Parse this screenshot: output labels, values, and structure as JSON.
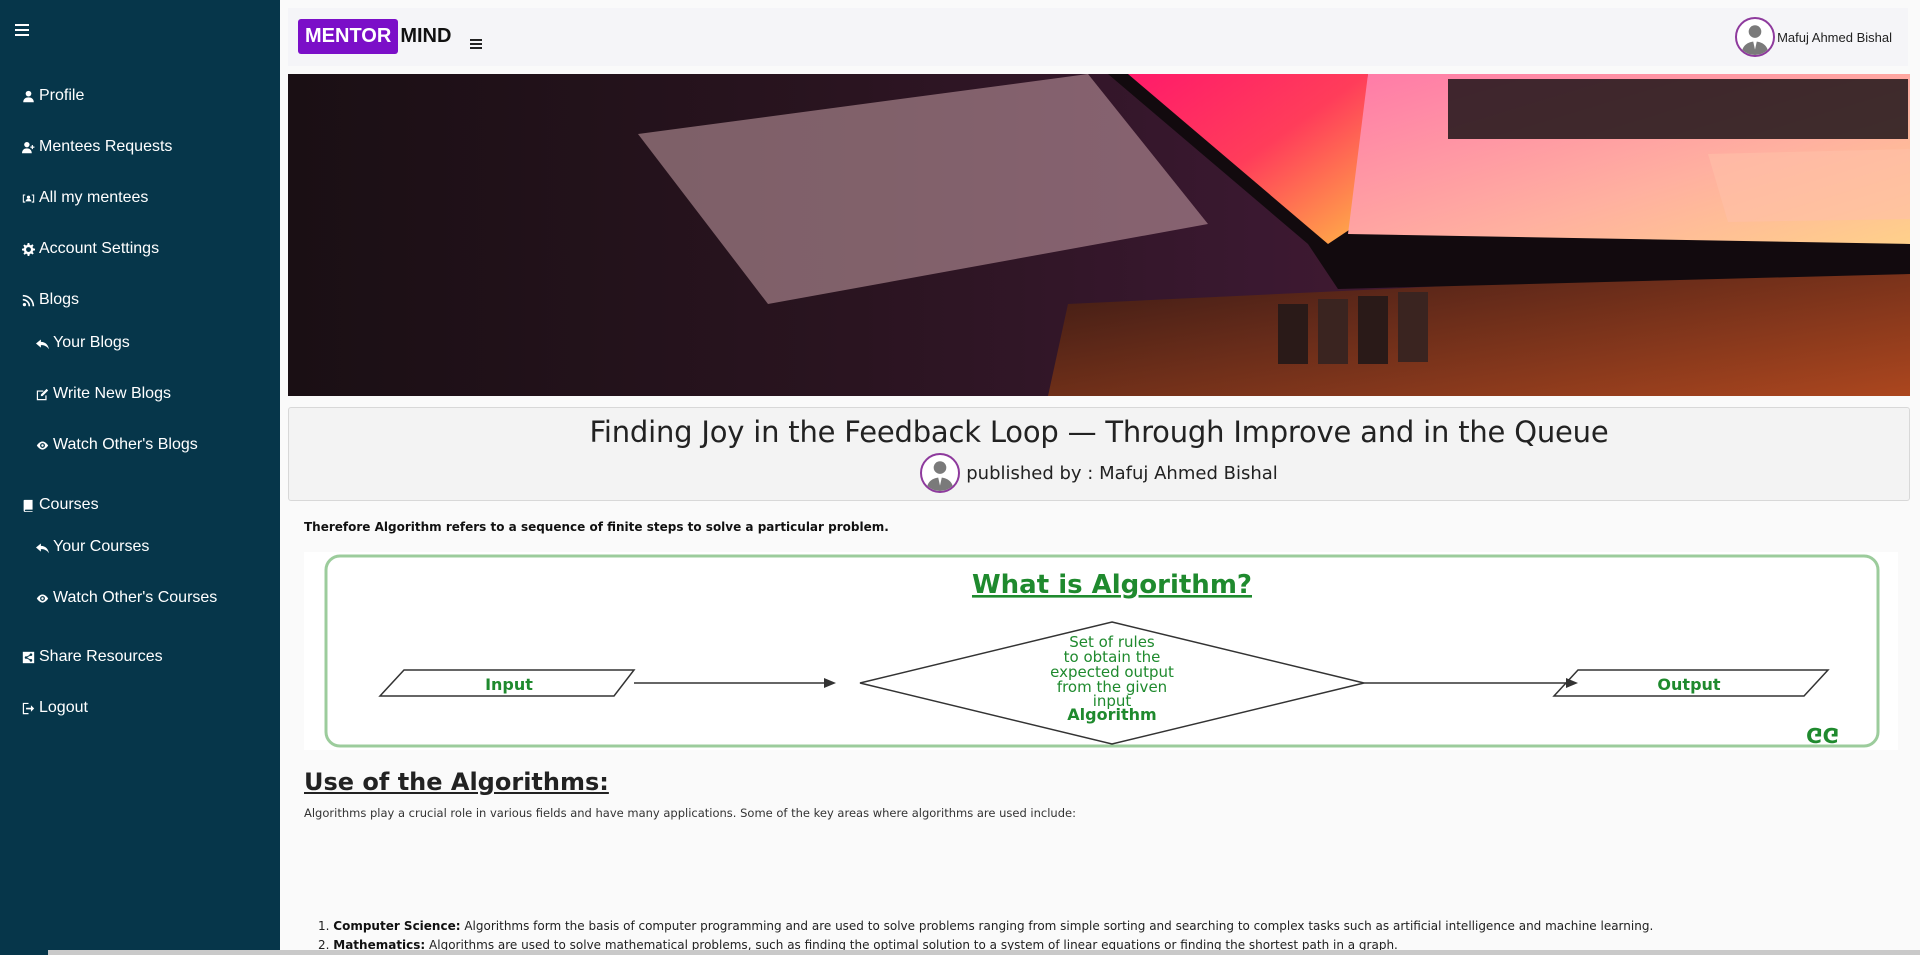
{
  "sidebar": {
    "items": [
      {
        "label": "Profile",
        "icon": "user-icon"
      },
      {
        "label": "Mentees Requests",
        "icon": "user-plus-icon"
      },
      {
        "label": "All my mentees",
        "icon": "people-card-icon"
      },
      {
        "label": "Account Settings",
        "icon": "gear-icon"
      },
      {
        "label": "Blogs",
        "icon": "rss-icon"
      },
      {
        "label": "Your Blogs",
        "icon": "reply-arrow-icon"
      },
      {
        "label": "Write New Blogs",
        "icon": "edit-icon"
      },
      {
        "label": "Watch Other's Blogs",
        "icon": "eye-icon"
      },
      {
        "label": "Courses",
        "icon": "book-icon"
      },
      {
        "label": "Your Courses",
        "icon": "reply-arrow-icon"
      },
      {
        "label": "Watch Other's Courses",
        "icon": "eye-icon"
      },
      {
        "label": "Share Resources",
        "icon": "share-icon"
      },
      {
        "label": "Logout",
        "icon": "logout-icon"
      }
    ]
  },
  "header": {
    "logo_part1": "MENTOR",
    "logo_part2": "MIND",
    "user_name": "Mafuj Ahmed Bishal"
  },
  "blog": {
    "title": "Finding Joy in the Feedback Loop — Through Improve and in the Queue",
    "published_by": "published by : Mafuj Ahmed Bishal",
    "intro": "Therefore Algorithm refers to a sequence of finite steps to solve a particular problem.",
    "diagram": {
      "title": "What is Algorithm?",
      "input": "Input",
      "rules_line1": "Set of rules",
      "rules_line2": "to obtain the",
      "rules_line3": "expected output",
      "rules_line4": "from the given",
      "rules_line5": "input",
      "algorithm": "Algorithm",
      "output": "Output",
      "watermark": "GG"
    },
    "section_heading": "Use of the Algorithms:",
    "section_para": "Algorithms play a crucial role in various fields and have many applications. Some of the key areas where algorithms are used include:",
    "list": [
      {
        "term": "Computer Science:",
        "text": " Algorithms form the basis of computer programming and are used to solve problems ranging from simple sorting and searching to complex tasks such as artificial intelligence and machine learning."
      },
      {
        "term": "Mathematics:",
        "text": " Algorithms are used to solve mathematical problems, such as finding the optimal solution to a system of linear equations or finding the shortest path in a graph."
      }
    ]
  },
  "colors": {
    "sidebar_bg": "#06364a",
    "logo_accent": "#7b0fc8",
    "avatar_border": "#8e3a9d",
    "diagram_green": "#1f8a2e"
  }
}
